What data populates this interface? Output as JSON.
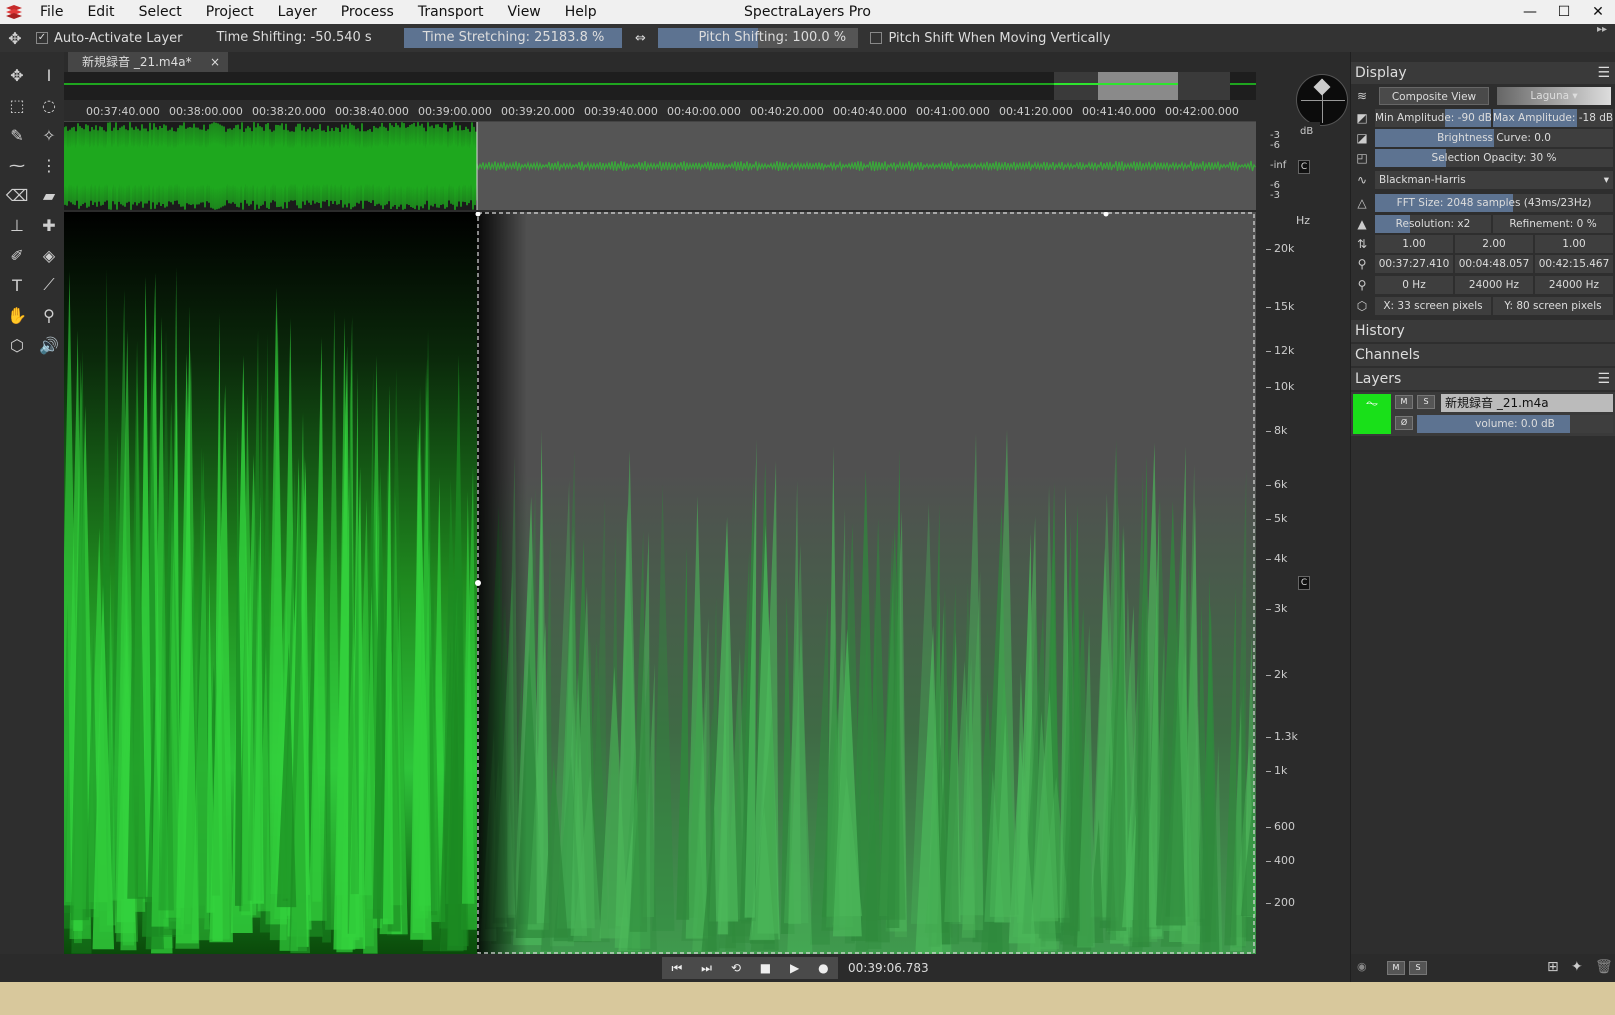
{
  "app": {
    "title": "SpectraLayers Pro",
    "menu": [
      "File",
      "Edit",
      "Select",
      "Project",
      "Layer",
      "Process",
      "Transport",
      "View",
      "Help"
    ],
    "window_controls": [
      "—",
      "☐",
      "✕"
    ]
  },
  "options": {
    "auto_activate_label": "Auto-Activate Layer",
    "auto_activate_checked": "✓",
    "time_shifting": "Time Shifting: -50.540 s",
    "time_stretching": "Time Stretching: 25183.8 %",
    "link_icon": "⇔",
    "pitch_shifting": "Pitch Shifting: 100.0 %",
    "pitch_shift_vertical_label": "Pitch Shift When Moving Vertically"
  },
  "document": {
    "tab_title": "新規録音 _21.m4a*",
    "tab_close": "×"
  },
  "ruler": {
    "labels": [
      "00:37:40.000",
      "00:38:00.000",
      "00:38:20.000",
      "00:38:40.000",
      "00:39:00.000",
      "00:39:20.000",
      "00:39:40.000",
      "00:40:00.000",
      "00:40:20.000",
      "00:40:40.000",
      "00:41:00.000",
      "00:41:20.000",
      "00:41:40.000",
      "00:42:00.000"
    ]
  },
  "db_scale": {
    "unit": "dB",
    "labels": [
      "-3",
      "-6",
      "-inf",
      "-6",
      "-3"
    ],
    "channel_label": "C"
  },
  "hz_scale": {
    "unit": "Hz",
    "labels": [
      "20k",
      "15k",
      "12k",
      "10k",
      "8k",
      "6k",
      "5k",
      "4k",
      "3k",
      "2k",
      "1.3k",
      "1k",
      "600",
      "400",
      "200"
    ],
    "channel_label": "C"
  },
  "transport": {
    "buttons": [
      "⏮",
      "⏭",
      "⟲",
      "■",
      "▶",
      "●"
    ],
    "timecode": "00:39:06.783"
  },
  "panel": {
    "display": {
      "header": "Display",
      "composite_view": "Composite View",
      "colormap": "Laguna",
      "min_amplitude": "Min Amplitude: -90 dB",
      "max_amplitude": "Max Amplitude: -18 dB",
      "brightness_curve": "Brightness Curve: 0.0",
      "selection_opacity": "Selection Opacity: 30 %",
      "window": "Blackman-Harris",
      "fft_size": "FFT Size: 2048 samples (43ms/23Hz)",
      "resolution": "Resolution: x2",
      "refinement": "Refinement: 0 %",
      "ratios": [
        "1.00",
        "2.00",
        "1.00"
      ],
      "times": [
        "00:37:27.410",
        "00:04:48.057",
        "00:42:15.467"
      ],
      "freqs": [
        "0  Hz",
        "24000  Hz",
        "24000  Hz"
      ],
      "x_pixels": "X: 33  screen pixels",
      "y_pixels": "Y: 80 screen pixels"
    },
    "history": "History",
    "channels": "Channels",
    "layers": {
      "header": "Layers",
      "layer_name": "新規録音 _21.m4a",
      "mute": "M",
      "solo": "S",
      "phase": "Ø",
      "volume": "volume: 0.0 dB"
    }
  },
  "colors": {
    "accent": "#5d7391",
    "spectral_green": "#2ec43a",
    "layer_green": "#19e019"
  }
}
